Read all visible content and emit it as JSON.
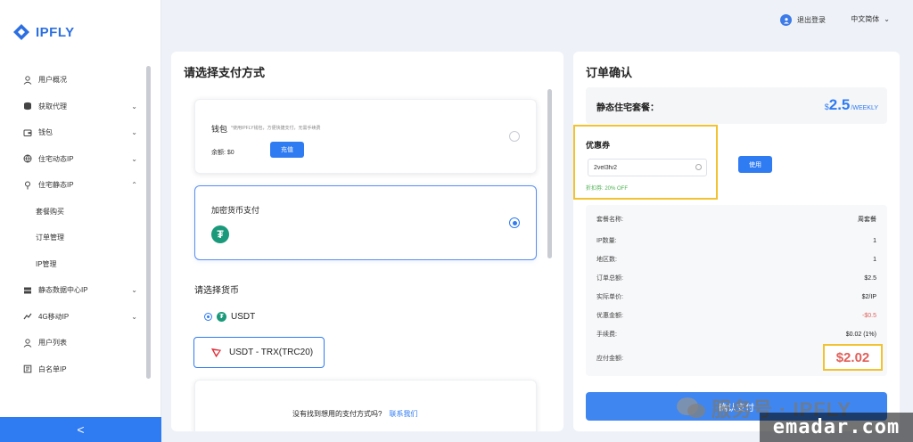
{
  "brand": {
    "logo_text": "IPFLY"
  },
  "topbar": {
    "logout": "退出登录",
    "language": "中文简体"
  },
  "sidebar": {
    "items": [
      {
        "label": "用户概况",
        "icon": "user-icon"
      },
      {
        "label": "获取代理",
        "icon": "database-icon"
      },
      {
        "label": "钱包",
        "icon": "wallet-icon"
      },
      {
        "label": "住宅动态IP",
        "icon": "globe-icon"
      },
      {
        "label": "住宅静态IP",
        "icon": "pin-icon"
      },
      {
        "label": "套餐购买",
        "sub": true
      },
      {
        "label": "订单管理",
        "sub": true
      },
      {
        "label": "IP管理",
        "sub": true
      },
      {
        "label": "静态数据中心IP",
        "icon": "server-icon"
      },
      {
        "label": "4G移动IP",
        "icon": "signal-icon"
      },
      {
        "label": "用户列表",
        "icon": "users-icon"
      },
      {
        "label": "白名单IP",
        "icon": "whitelist-icon"
      }
    ],
    "collapse": "<"
  },
  "payment": {
    "title": "请选择支付方式",
    "wallet": {
      "title": "钱包",
      "desc": "*使用IPFLY钱包，方便快捷支付，无需手续费",
      "balance_label": "余额:",
      "balance_value": "$0",
      "recharge": "充值"
    },
    "crypto": {
      "title": "加密货币支付",
      "icon": "tether-icon"
    },
    "currency_label": "请选择货币",
    "currency": "USDT",
    "network": "USDT - TRX(TRC20)",
    "footer_text": "没有找到想用的支付方式吗?",
    "footer_link": "联系我们"
  },
  "order": {
    "title": "订单确认",
    "package_label": "静态住宅套餐：",
    "price_symbol": "$",
    "price_value": "2.5",
    "price_unit": "/WEEKLY",
    "coupon_label": "优惠券",
    "coupon_value": "2vel3fv2",
    "discount_note": "折扣券: 20% OFF",
    "use_button": "使用",
    "rows": [
      {
        "label": "套餐名称:",
        "value": "周套餐"
      },
      {
        "label": "IP数量:",
        "value": "1"
      },
      {
        "label": "地区数:",
        "value": "1"
      },
      {
        "label": "订单总额:",
        "value": "$2.5"
      },
      {
        "label": "实际单价:",
        "value": "$2/IP"
      },
      {
        "label": "优惠金额:",
        "value": "-$0.5"
      },
      {
        "label": "手续费:",
        "value": "$0.02 (1%)"
      },
      {
        "label": "应付金额:",
        "value": "$2.02"
      }
    ],
    "confirm_button": "确认支付"
  },
  "watermarks": {
    "wechat": "服务号 · IPFLY",
    "site": "emadar.com"
  },
  "colors": {
    "accent": "#2f7bf2",
    "highlight": "#f2c230",
    "negative": "#e0605a",
    "success": "#4caf50",
    "tether": "#1a9a7a"
  }
}
